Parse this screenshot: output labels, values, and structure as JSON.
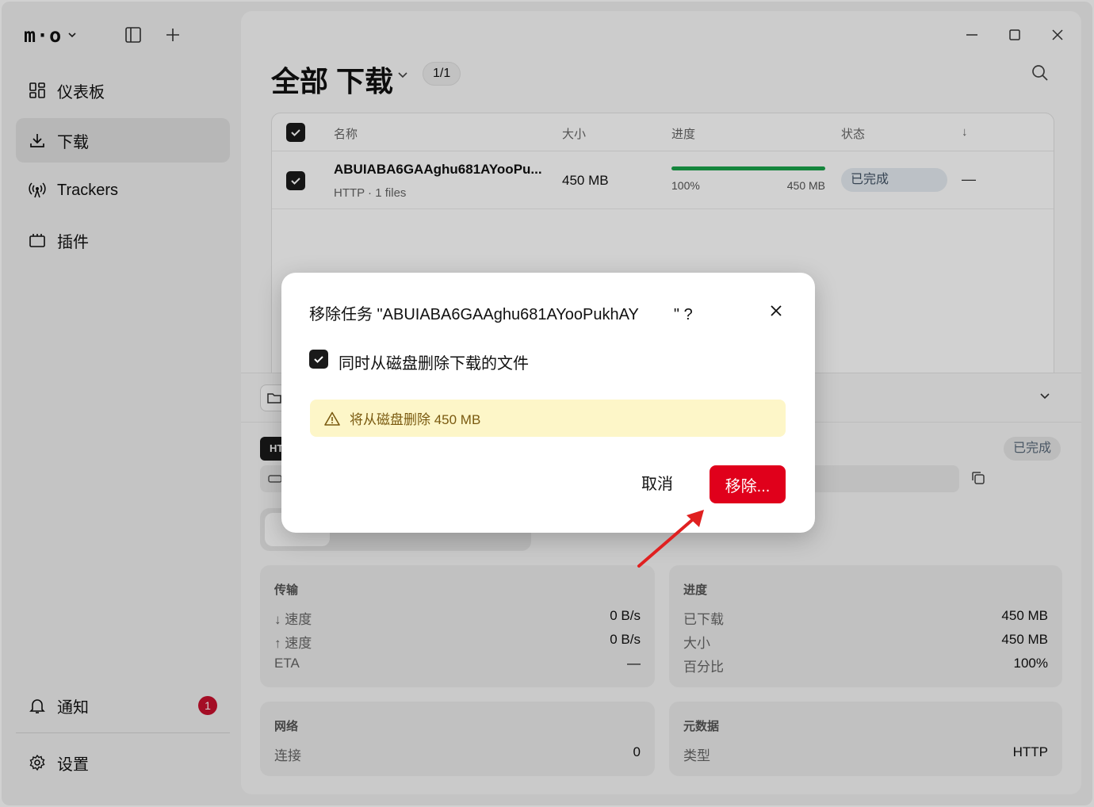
{
  "app": {
    "logo_text": "m·o"
  },
  "sidebar": {
    "items": [
      {
        "label": "仪表板",
        "icon": "dashboard-icon"
      },
      {
        "label": "下载",
        "icon": "download-icon",
        "active": true
      },
      {
        "label": "Trackers",
        "icon": "broadcast-icon"
      },
      {
        "label": "插件",
        "icon": "plugin-icon"
      }
    ],
    "notifications": {
      "label": "通知",
      "count": "1"
    },
    "settings": {
      "label": "设置"
    }
  },
  "main": {
    "title": "全部 下载",
    "count": "1/1",
    "table": {
      "headers": {
        "name": "名称",
        "size": "大小",
        "progress": "进度",
        "status": "状态",
        "sort": "↓"
      },
      "rows": [
        {
          "name": "ABUIABA6GAAghu681AYooPu...",
          "meta": "HTTP · 1 files",
          "size": "450 MB",
          "progress_fraction": 1.0,
          "progress_pct": "100%",
          "progress_size": "450 MB",
          "status": "已完成",
          "extra": "—"
        }
      ]
    },
    "detail": {
      "protocol_tag": "HTTP",
      "status": "已完成",
      "transfer": {
        "title": "传输",
        "rows": [
          {
            "k": "↓ 速度",
            "v": "0 B/s"
          },
          {
            "k": "↑ 速度",
            "v": "0 B/s"
          },
          {
            "k": "ETA",
            "v": "—"
          }
        ]
      },
      "progress": {
        "title": "进度",
        "rows": [
          {
            "k": "已下载",
            "v": "450 MB"
          },
          {
            "k": "大小",
            "v": "450 MB"
          },
          {
            "k": "百分比",
            "v": "100%"
          }
        ]
      },
      "network": {
        "title": "网络",
        "rows": [
          {
            "k": "连接",
            "v": "0"
          }
        ]
      },
      "metadata": {
        "title": "元数据",
        "rows": [
          {
            "k": "类型",
            "v": "HTTP"
          }
        ]
      }
    }
  },
  "dialog": {
    "title": "移除任务 \"ABUIABA6GAAghu681AYooPukhAY        \" ?",
    "checkbox_label": "同时从磁盘删除下载的文件",
    "checkbox_checked": true,
    "warning": "将从磁盘删除 450 MB",
    "cancel": "取消",
    "confirm": "移除..."
  },
  "colors": {
    "accent_red": "#e0001b",
    "progress_green": "#1aa34a",
    "warning_bg": "#fdf6c8",
    "badge_red": "#c8102e"
  }
}
